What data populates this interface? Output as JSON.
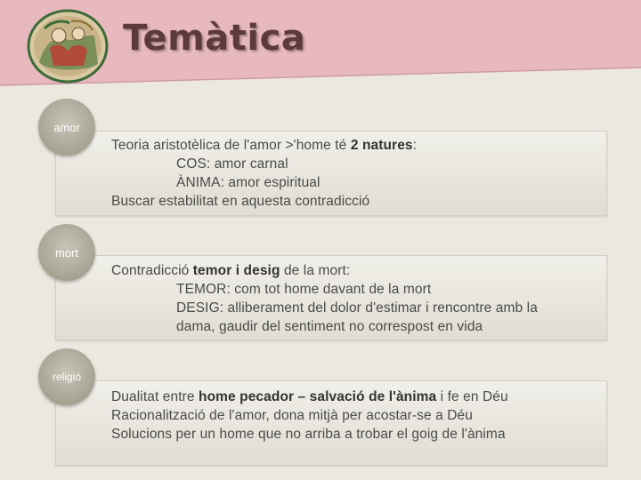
{
  "title": "Temàtica",
  "colors": {
    "banner": "#e8b8bf",
    "circle": "#a9a596",
    "text": "#4a4a4a"
  },
  "sections": [
    {
      "label": "amor",
      "lines": [
        {
          "type": "main",
          "text": "Teoria aristotèlica de l'amor >'home té ",
          "bold": "2 natures",
          "after": ":"
        },
        {
          "type": "indent",
          "text": "COS: amor carnal"
        },
        {
          "type": "indent",
          "text": "ÀNIMA: amor espiritual"
        },
        {
          "type": "main",
          "text": "Buscar estabilitat en aquesta contradicció"
        }
      ]
    },
    {
      "label": "mort",
      "lines": [
        {
          "type": "main",
          "text": "Contradicció ",
          "bold": "temor i desig",
          "after": " de la mort:"
        },
        {
          "type": "indent",
          "text": "TEMOR: com tot home davant de la mort"
        },
        {
          "type": "indent",
          "text": "DESIG: alliberament del dolor d'estimar i rencontre amb la"
        },
        {
          "type": "indent",
          "text": "dama, gaudir del sentiment no correspost en vida"
        }
      ]
    },
    {
      "label": "religió",
      "lines": [
        {
          "type": "main",
          "text": "Dualitat entre ",
          "bold": "home pecador – salvació de l'ànima",
          "after": " i fe en Déu"
        },
        {
          "type": "main",
          "text": "Racionalització de l'amor, dona mitjà per acostar-se a Déu"
        },
        {
          "type": "main",
          "text": "Solucions per un home que no arriba a trobar el goig de l'ànima"
        }
      ]
    }
  ]
}
